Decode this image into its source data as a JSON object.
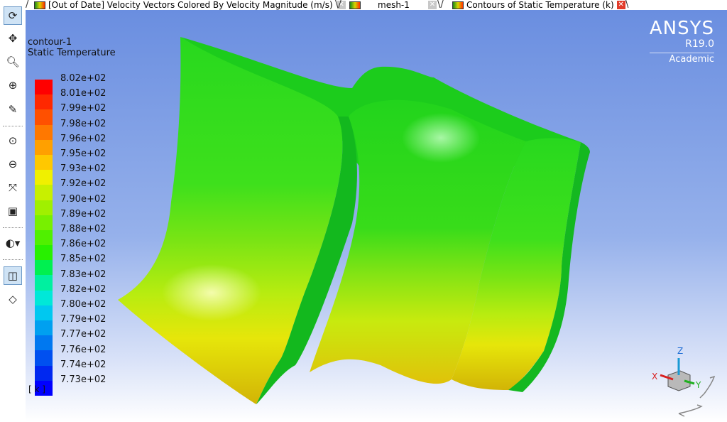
{
  "tabs": [
    {
      "label": "[Out of Date] Velocity Vectors Colored By Velocity Magnitude (m/s)",
      "active": false
    },
    {
      "label": "mesh-1",
      "active": false
    },
    {
      "label": "Contours of Static Temperature (k)",
      "active": true
    }
  ],
  "toolbar": [
    "rotate-icon",
    "pan-icon",
    "zoom-icon",
    "zoom-in-icon",
    "probe-icon",
    "zoom-box-icon",
    "zoom-out-icon",
    "fit-icon",
    "screenshot-icon",
    "view-options-icon",
    "perspective-icon",
    "orthographic-icon"
  ],
  "legend": {
    "name": "contour-1",
    "variable": "Static Temperature",
    "units": "[ k ]",
    "ticks": [
      "8.02e+02",
      "8.01e+02",
      "7.99e+02",
      "7.98e+02",
      "7.96e+02",
      "7.95e+02",
      "7.93e+02",
      "7.92e+02",
      "7.90e+02",
      "7.89e+02",
      "7.88e+02",
      "7.86e+02",
      "7.85e+02",
      "7.83e+02",
      "7.82e+02",
      "7.80e+02",
      "7.79e+02",
      "7.77e+02",
      "7.76e+02",
      "7.74e+02",
      "7.73e+02"
    ],
    "colors": [
      "#ff0000",
      "#ff2800",
      "#ff5000",
      "#ff7800",
      "#ffa000",
      "#ffc800",
      "#f0f000",
      "#c8f000",
      "#a0f000",
      "#78f000",
      "#50f000",
      "#28f000",
      "#00f050",
      "#00f0a0",
      "#00e8d8",
      "#00c8f0",
      "#00a0f0",
      "#0078f0",
      "#0050f0",
      "#0028f0",
      "#0000ff"
    ]
  },
  "logo": {
    "name": "ANSYS",
    "version": "R19.0",
    "edition": "Academic"
  },
  "triad": {
    "x": "X",
    "y": "Y",
    "z": "Z"
  }
}
